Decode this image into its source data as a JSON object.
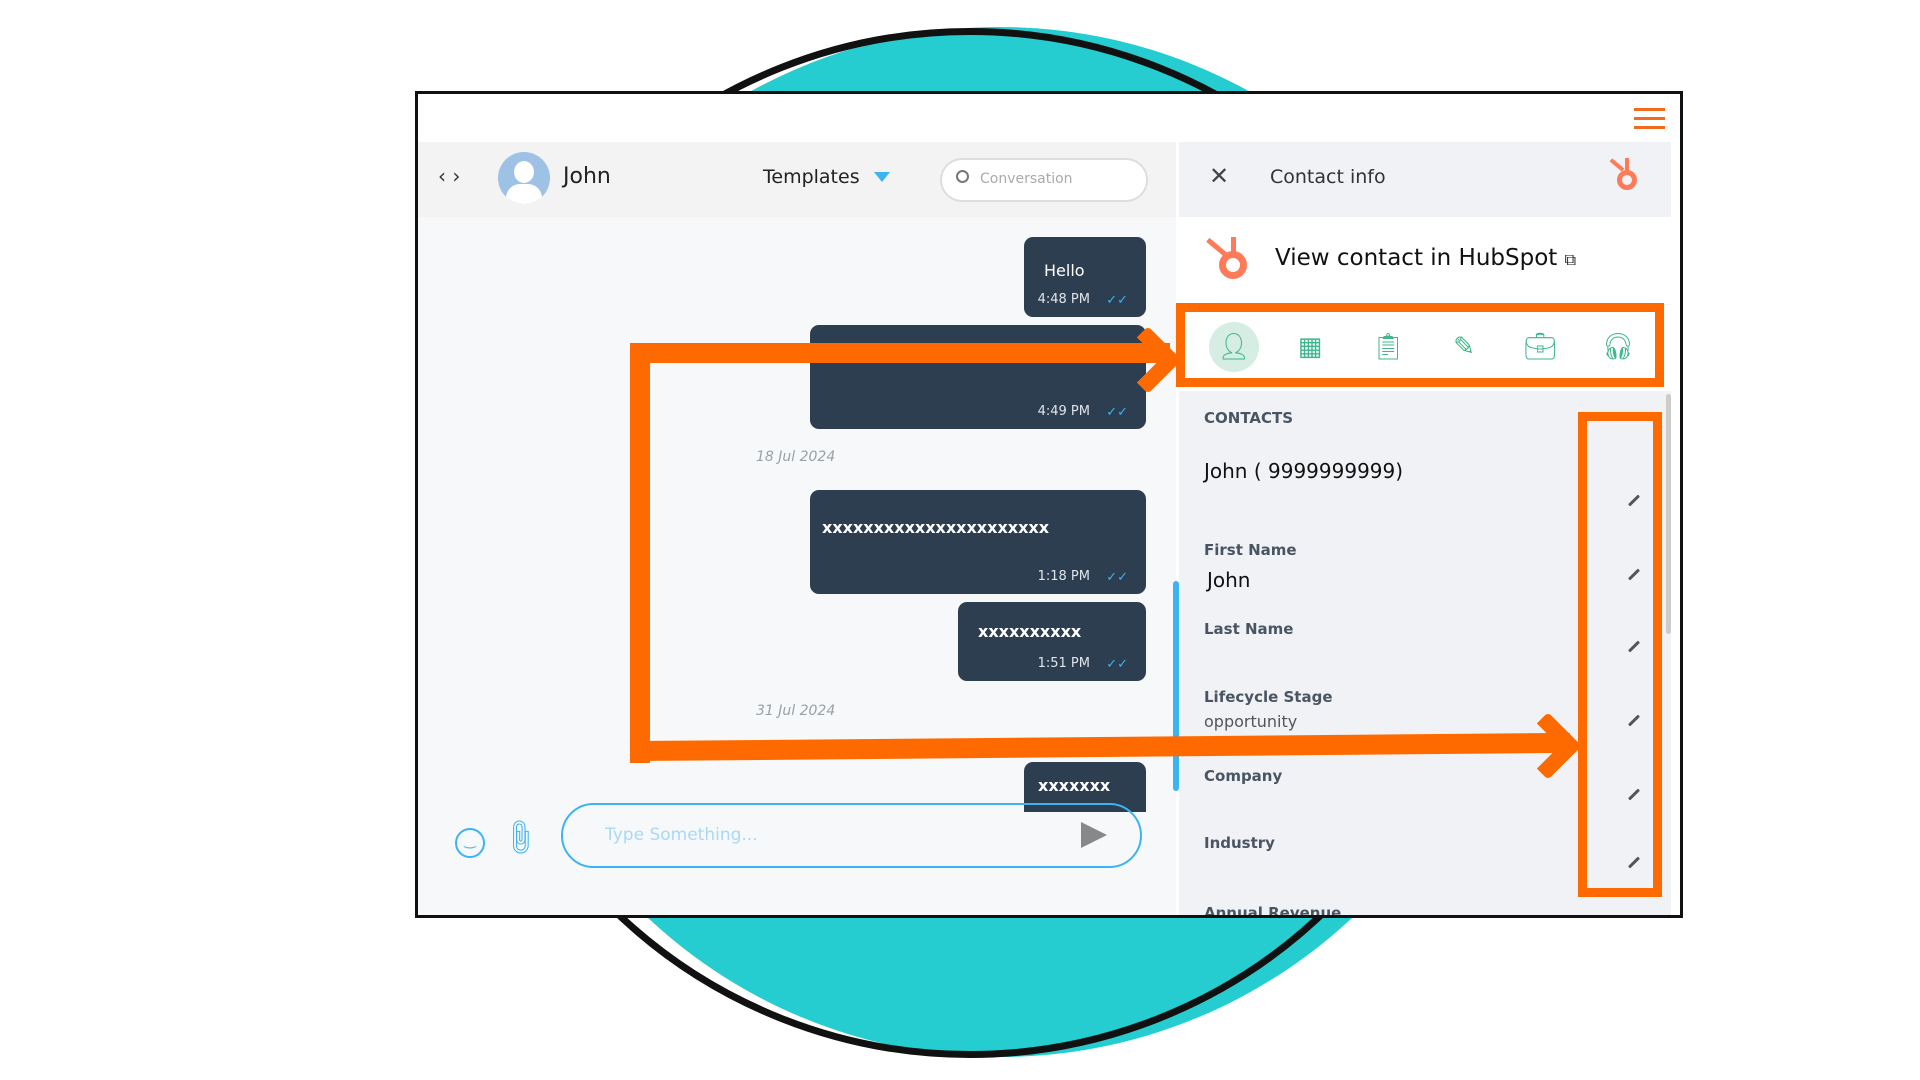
{
  "colors": {
    "accent_orange": "#ff6a00",
    "teal": "#25cdd1",
    "bubble": "#2d3e50",
    "hubspot": "#ff7a59",
    "icon_green": "#3fb68b"
  },
  "chat": {
    "contact_name": "John",
    "templates_label": "Templates",
    "search_placeholder": "Conversation",
    "messages": [
      {
        "text": "Hello",
        "time": "4:48 PM"
      },
      {
        "text": "",
        "time": "4:49 PM"
      },
      {
        "text": "xxxxxxxxxxxxxxxxxxxxxx",
        "time": "1:18 PM"
      },
      {
        "text": "xxxxxxxxxx",
        "time": "1:51 PM"
      },
      {
        "text": "xxxxxxx",
        "time": ""
      }
    ],
    "dates": [
      "18 Jul 2024",
      "31 Jul 2024"
    ],
    "input_placeholder": "Type Something..."
  },
  "panel": {
    "title": "Contact info",
    "view_link": "View contact in HubSpot",
    "tabs": [
      "contact-icon",
      "company-icon",
      "task-icon",
      "note-icon",
      "deal-icon",
      "ticket-icon"
    ],
    "section": "CONTACTS",
    "contact_summary": "John ( 9999999999)",
    "fields": [
      {
        "label": "First Name",
        "value": "John"
      },
      {
        "label": "Last Name",
        "value": ""
      },
      {
        "label": "Lifecycle Stage",
        "value": "opportunity"
      },
      {
        "label": "Company",
        "value": ""
      },
      {
        "label": "Industry",
        "value": ""
      },
      {
        "label": "Annual Revenue",
        "value": ""
      }
    ]
  }
}
